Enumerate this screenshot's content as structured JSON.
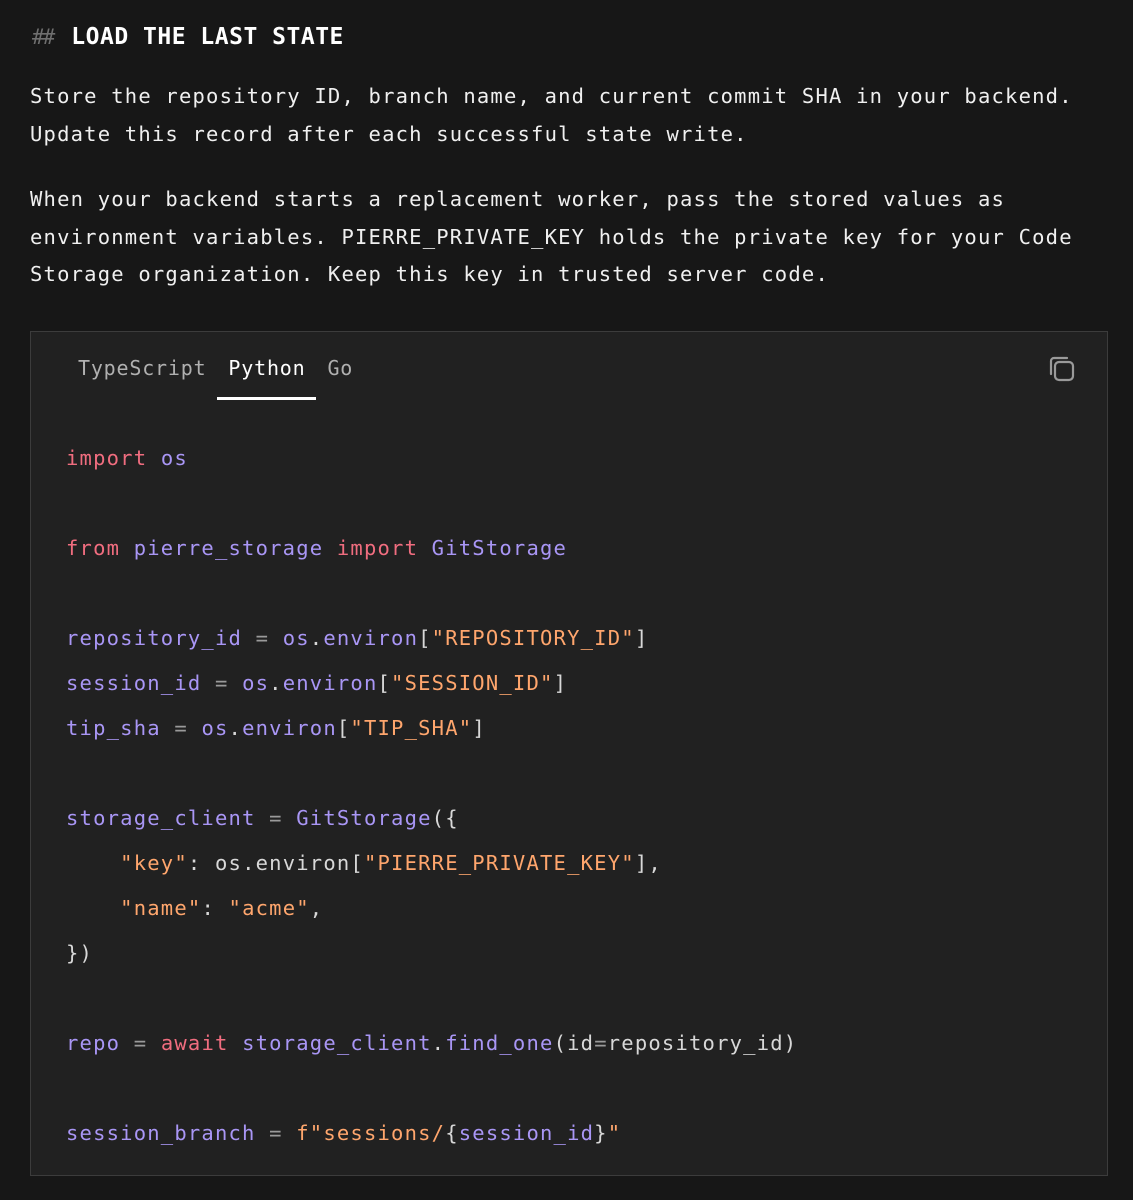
{
  "heading": {
    "marker": "##",
    "title": "LOAD THE LAST STATE"
  },
  "paragraphs": [
    "Store the repository ID, branch name, and current commit SHA in your backend. Update this record after each successful state write.",
    "When your backend starts a replacement worker, pass the stored values as environment variables. PIERRE_PRIVATE_KEY holds the private key for your Code Storage organization. Keep this key in trusted server code."
  ],
  "code_block": {
    "tabs": [
      "TypeScript",
      "Python",
      "Go"
    ],
    "active_tab": "Python",
    "copy_icon": "copy-icon",
    "colors": {
      "keyword": "#f06d7f",
      "identifier": "#a996f5",
      "string": "#ffa66d",
      "punctuation": "#9a9a9a"
    },
    "lines": [
      [
        {
          "t": "import",
          "c": "kw"
        },
        {
          "t": " "
        },
        {
          "t": "os",
          "c": "id"
        }
      ],
      [],
      [
        {
          "t": "from",
          "c": "kw"
        },
        {
          "t": " "
        },
        {
          "t": "pierre_storage",
          "c": "id"
        },
        {
          "t": " "
        },
        {
          "t": "import",
          "c": "kw"
        },
        {
          "t": " "
        },
        {
          "t": "GitStorage",
          "c": "id"
        }
      ],
      [],
      [
        {
          "t": "repository_id",
          "c": "id"
        },
        {
          "t": " = ",
          "c": "op"
        },
        {
          "t": "os",
          "c": "id"
        },
        {
          "t": ".",
          "c": "pl"
        },
        {
          "t": "environ",
          "c": "id"
        },
        {
          "t": "[",
          "c": "pl"
        },
        {
          "t": "\"REPOSITORY_ID\"",
          "c": "str"
        },
        {
          "t": "]",
          "c": "pl"
        }
      ],
      [
        {
          "t": "session_id",
          "c": "id"
        },
        {
          "t": " = ",
          "c": "op"
        },
        {
          "t": "os",
          "c": "id"
        },
        {
          "t": ".",
          "c": "pl"
        },
        {
          "t": "environ",
          "c": "id"
        },
        {
          "t": "[",
          "c": "pl"
        },
        {
          "t": "\"SESSION_ID\"",
          "c": "str"
        },
        {
          "t": "]",
          "c": "pl"
        }
      ],
      [
        {
          "t": "tip_sha",
          "c": "id"
        },
        {
          "t": " = ",
          "c": "op"
        },
        {
          "t": "os",
          "c": "id"
        },
        {
          "t": ".",
          "c": "pl"
        },
        {
          "t": "environ",
          "c": "id"
        },
        {
          "t": "[",
          "c": "pl"
        },
        {
          "t": "\"TIP_SHA\"",
          "c": "str"
        },
        {
          "t": "]",
          "c": "pl"
        }
      ],
      [],
      [
        {
          "t": "storage_client",
          "c": "id"
        },
        {
          "t": " = ",
          "c": "op"
        },
        {
          "t": "GitStorage",
          "c": "id"
        },
        {
          "t": "({",
          "c": "pl"
        }
      ],
      [
        {
          "t": "    "
        },
        {
          "t": "\"key\"",
          "c": "str"
        },
        {
          "t": ": ",
          "c": "pl"
        },
        {
          "t": "os",
          "c": "pl"
        },
        {
          "t": ".",
          "c": "pl"
        },
        {
          "t": "environ",
          "c": "pl"
        },
        {
          "t": "[",
          "c": "pl"
        },
        {
          "t": "\"PIERRE_PRIVATE_KEY\"",
          "c": "str"
        },
        {
          "t": "],",
          "c": "pl"
        }
      ],
      [
        {
          "t": "    "
        },
        {
          "t": "\"name\"",
          "c": "str"
        },
        {
          "t": ": ",
          "c": "pl"
        },
        {
          "t": "\"acme\"",
          "c": "str"
        },
        {
          "t": ",",
          "c": "pl"
        }
      ],
      [
        {
          "t": "})",
          "c": "pl"
        }
      ],
      [],
      [
        {
          "t": "repo",
          "c": "id"
        },
        {
          "t": " = ",
          "c": "op"
        },
        {
          "t": "await",
          "c": "kw"
        },
        {
          "t": " "
        },
        {
          "t": "storage_client",
          "c": "id"
        },
        {
          "t": ".",
          "c": "pl"
        },
        {
          "t": "find_one",
          "c": "id"
        },
        {
          "t": "(",
          "c": "pl"
        },
        {
          "t": "id",
          "c": "pl"
        },
        {
          "t": "=",
          "c": "op"
        },
        {
          "t": "repository_id",
          "c": "pl"
        },
        {
          "t": ")",
          "c": "pl"
        }
      ],
      [],
      [
        {
          "t": "session_branch",
          "c": "id"
        },
        {
          "t": " = ",
          "c": "op"
        },
        {
          "t": "f\"sessions/",
          "c": "str"
        },
        {
          "t": "{",
          "c": "pl"
        },
        {
          "t": "session_id",
          "c": "id"
        },
        {
          "t": "}",
          "c": "pl"
        },
        {
          "t": "\"",
          "c": "str"
        }
      ]
    ]
  }
}
